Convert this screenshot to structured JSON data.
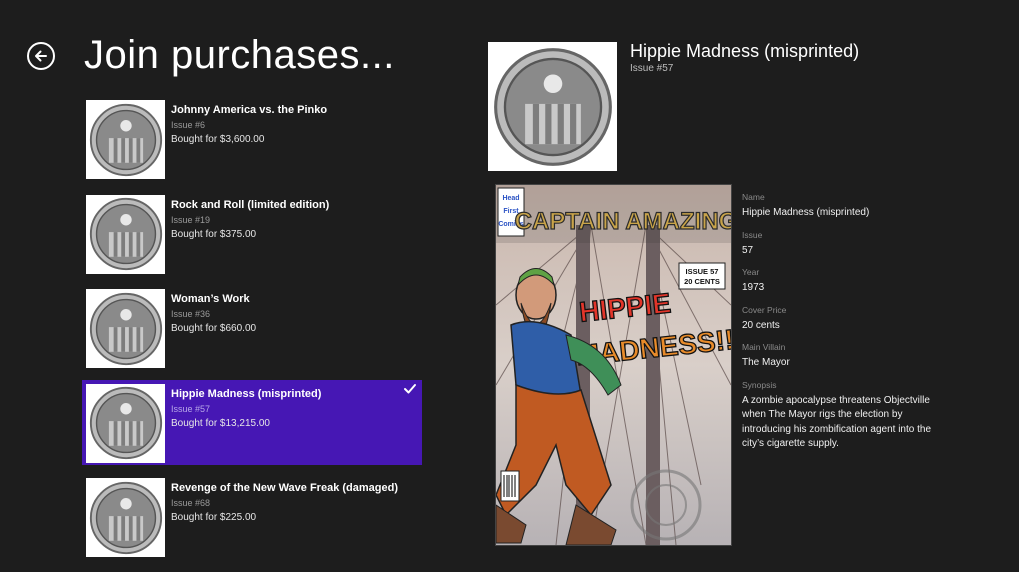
{
  "page": {
    "title": "Join purchases..."
  },
  "purchases": [
    {
      "name": "Johnny America vs. the Pinko",
      "issue": "Issue #6",
      "price": "Bought for $3,600.00"
    },
    {
      "name": "Rock and Roll (limited edition)",
      "issue": "Issue #19",
      "price": "Bought for $375.00"
    },
    {
      "name": "Woman’s Work",
      "issue": "Issue #36",
      "price": "Bought for $660.00"
    },
    {
      "name": "Hippie Madness (misprinted)",
      "issue": "Issue #57",
      "price": "Bought for $13,215.00"
    },
    {
      "name": "Revenge of the New Wave Freak (damaged)",
      "issue": "Issue #68",
      "price": "Bought for $225.00"
    }
  ],
  "selected_index": 3,
  "detail": {
    "title": "Hippie Madness (misprinted)",
    "subtitle": "Issue #57",
    "cover": {
      "publisher_lines": [
        "Head",
        "First",
        "Comics"
      ],
      "series": "CAPTAIN AMAZING",
      "issue_box": [
        "ISSUE 57",
        "20 CENTS"
      ],
      "story_lines": [
        "HIPPIE",
        "MADNESS!!"
      ]
    },
    "properties": [
      {
        "label": "Name",
        "value": "Hippie Madness (misprinted)"
      },
      {
        "label": "Issue",
        "value": "57"
      },
      {
        "label": "Year",
        "value": "1973"
      },
      {
        "label": "Cover Price",
        "value": "20 cents"
      },
      {
        "label": "Main Villain",
        "value": "The Mayor"
      },
      {
        "label": "Synopsis",
        "value": "A zombie apocalypse threatens Objectville when The Mayor rigs the election by introducing his zombification agent into the city’s cigarette supply."
      }
    ]
  },
  "colors": {
    "background": "#1d1d1d",
    "selection": "#4617b4"
  },
  "icons": {
    "back": "back-arrow-icon",
    "check": "checkmark-icon",
    "thumbnail": "comic-token-icon"
  }
}
